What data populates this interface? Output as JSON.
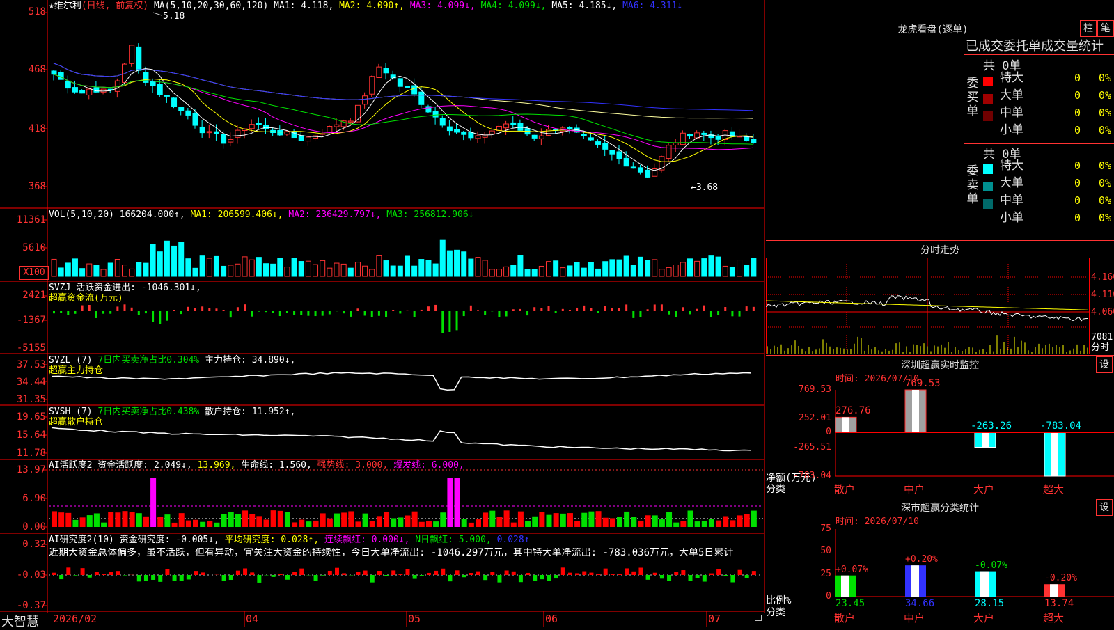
{
  "app": {
    "name": "大智慧"
  },
  "main_chart": {
    "title": "★维尔利",
    "period": "(日线, 前复权)",
    "ma_label": "MA(5,10,20,30,60,120)",
    "ma1": "MA1: 4.118,",
    "ma2": "MA2: 4.090↑,",
    "ma3": "MA3: 4.099↓,",
    "ma4": "MA4: 4.099↓,",
    "ma5": "MA5: 4.185↓,",
    "ma6": "MA6: 4.311↓",
    "high_mark": "5.18",
    "low_mark": "←3.68",
    "y_ticks": [
      "518",
      "468",
      "418",
      "368"
    ]
  },
  "vol_chart": {
    "label": "VOL(5,10,20)",
    "val": "166204.000↑,",
    "ma1": "MA1: 206599.406↓,",
    "ma2": "MA2: 236429.797↓,",
    "ma3": "MA3: 256812.906↓",
    "y_ticks": [
      "11361",
      "5610",
      "X100"
    ]
  },
  "svzj": {
    "label": "SVZJ  活跃资金进出: -1046.301↓,",
    "sub": "超赢资金流(万元)",
    "y_ticks": [
      "2421",
      "-1367",
      "-5155"
    ]
  },
  "svzl": {
    "label": "SVZL (7)",
    "pct": "7日内买卖净占比0.304%",
    "hold": "主力持仓: 34.890↓,",
    "sub": "超赢主力持仓",
    "y_ticks": [
      "37.53",
      "34.44",
      "31.35"
    ]
  },
  "svsh": {
    "label": "SVSH (7)",
    "pct": "7日内买卖净占比0.438%",
    "hold": "散户持仓: 11.952↑,",
    "sub": "超赢散户持仓",
    "y_ticks": [
      "19.65",
      "15.64",
      "11.78"
    ]
  },
  "ai_active": {
    "label": "AI活跃度2 资金活跃度: 2.049↓,",
    "v2": "13.969,",
    "life": "生命线: 1.560,",
    "strong": "强势线: 3.000,",
    "burst": "爆发线: 6.000,",
    "y_ticks": [
      "13.97",
      "6.90",
      "0.00"
    ]
  },
  "ai_research": {
    "label": "AI研究度2(10) 资金研究度: -0.005↓,",
    "avg": "平均研究度: 0.028↑,",
    "lian": "连续飘红: 0.000↓,",
    "nday": "N日飘红: 5.000,",
    "v": "0.028↑",
    "comment": "近期大资金总体偏多，虽不活跃，但有异动，宜关注大资金的持续性，今日大单净流出: -1046.297万元，其中特大单净流出: -783.036万元，大单5日累计",
    "y_ticks": [
      "0.32",
      "-0.03",
      "-0.37"
    ]
  },
  "x_axis": [
    "2026/02",
    "04",
    "05",
    "06",
    "07"
  ],
  "dragon": {
    "title": "龙虎看盘(逐单)",
    "btn1": "柱",
    "btn2": "笔",
    "stat_title": "已成交委托单成交量统计",
    "buy": {
      "label": "委买单",
      "total": "共 0单",
      "rows": [
        {
          "name": "特大",
          "val": "0",
          "pct": "0%",
          "color": "#ff0000"
        },
        {
          "name": "大单",
          "val": "0",
          "pct": "0%",
          "color": "#a00000"
        },
        {
          "name": "中单",
          "val": "0",
          "pct": "0%",
          "color": "#700000"
        },
        {
          "name": "小单",
          "val": "0",
          "pct": "0%",
          "color": "#000000"
        }
      ]
    },
    "sell": {
      "label": "委卖单",
      "total": "共 0单",
      "rows": [
        {
          "name": "特大",
          "val": "0",
          "pct": "0%",
          "color": "#00ffff"
        },
        {
          "name": "大单",
          "val": "0",
          "pct": "0%",
          "color": "#009090"
        },
        {
          "name": "中单",
          "val": "0",
          "pct": "0%",
          "color": "#006a6a"
        },
        {
          "name": "小单",
          "val": "0",
          "pct": "0%",
          "color": "#000000"
        }
      ]
    }
  },
  "intraday": {
    "title": "分时走势",
    "y_ticks": [
      "4.160",
      "4.110",
      "4.060",
      "7081"
    ],
    "vol_unit": "分时"
  },
  "sz_monitor": {
    "title": "深圳超赢实时监控",
    "btn": "设",
    "time": "时间: 2026/07/10",
    "y_ticks": [
      "769.53",
      "252.01",
      "0",
      "-265.51",
      "-783.04"
    ],
    "ylabel": "净额(万元)",
    "xlabel": "分类",
    "categories": [
      "散户",
      "中户",
      "大户",
      "超大"
    ],
    "value_labels": [
      "276.76",
      "769.53",
      "-263.26",
      "-783.04"
    ]
  },
  "sz_class": {
    "title": "深市超赢分类统计",
    "btn": "设",
    "time": "时间: 2026/07/10",
    "y_ticks": [
      "75",
      "50",
      "25",
      "0"
    ],
    "ylabel": "比例%",
    "xlabel": "分类",
    "categories": [
      "散户",
      "中户",
      "大户",
      "超大"
    ],
    "change_labels": [
      "+0.07%",
      "+0.20%",
      "-0.07%",
      "-0.20%"
    ],
    "value_labels": [
      "23.45",
      "34.66",
      "28.15",
      "13.74"
    ]
  },
  "colors": {
    "up": "#ff3232",
    "down": "#00ffff",
    "grid": "#ff0000",
    "bg": "#000000"
  },
  "chart_data": [
    {
      "type": "bar",
      "title": "深圳超赢实时监控",
      "ylabel": "净额(万元)",
      "categories": [
        "散户",
        "中户",
        "大户",
        "超大"
      ],
      "values": [
        276.76,
        769.53,
        -263.26,
        -783.04
      ],
      "ylim": [
        -783.04,
        769.53
      ]
    },
    {
      "type": "bar",
      "title": "深市超赢分类统计",
      "ylabel": "比例%",
      "categories": [
        "散户",
        "中户",
        "大户",
        "超大"
      ],
      "values": [
        23.45,
        34.66,
        28.15,
        13.74
      ],
      "ylim": [
        0,
        75
      ]
    }
  ]
}
